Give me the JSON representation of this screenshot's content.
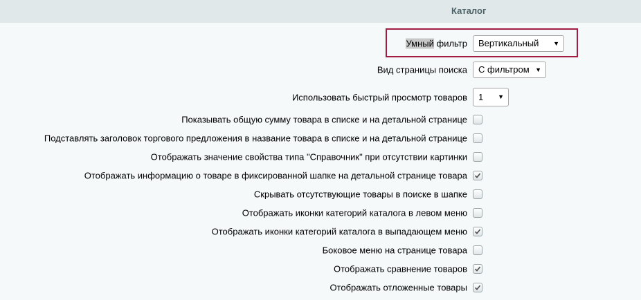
{
  "header": {
    "title": "Каталог"
  },
  "highlight_color": "#a01c43",
  "smart_filter": {
    "label_highlighted": "Умный",
    "label_rest": " фильтр",
    "value": "Вертикальный"
  },
  "search_view": {
    "label": "Вид страницы поиска",
    "value": "С фильтром"
  },
  "quick_view": {
    "label": "Использовать быстрый просмотр товаров",
    "value": "1"
  },
  "options": [
    {
      "label": "Показывать общую сумму товара в списке и на детальной странице",
      "checked": false
    },
    {
      "label": "Подставлять заголовок торгового предложения в название товара в списке и на детальной странице",
      "checked": false
    },
    {
      "label": "Отображать значение свойства типа \"Справочник\" при отсутствии картинки",
      "checked": false
    },
    {
      "label": "Отображать информацию о товаре в фиксированной шапке на детальной странице товара",
      "checked": true
    },
    {
      "label": "Скрывать отсутствующие товары в поиске в шапке",
      "checked": false
    },
    {
      "label": "Отображать иконки категорий каталога в левом меню",
      "checked": false
    },
    {
      "label": "Отображать иконки категорий каталога в выпадающем меню",
      "checked": true
    },
    {
      "label": "Боковое меню на странице товара",
      "checked": false
    },
    {
      "label": "Отображать сравнение товаров",
      "checked": true
    },
    {
      "label": "Отображать отложенные товары",
      "checked": true
    }
  ]
}
